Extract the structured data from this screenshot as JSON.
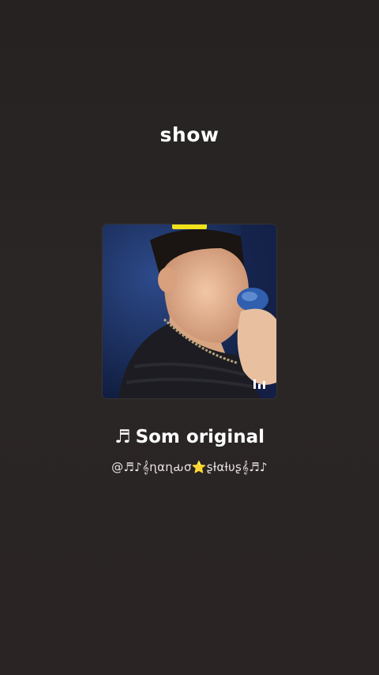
{
  "header": {
    "title": "show"
  },
  "track": {
    "cover_icon": "audio-bars-icon",
    "note_icon": "♬",
    "name": "Som original",
    "author": "@♬♪𝄞ɳαɳԃσ⭐ʂƚαƚυʂ𝄞♬♪"
  },
  "colors": {
    "background": "#2a2525",
    "accent_tag": "#f2e21c",
    "text": "#ffffff"
  }
}
